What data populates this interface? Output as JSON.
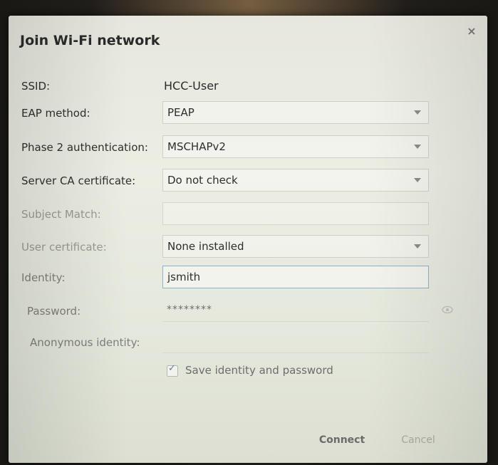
{
  "dialog": {
    "title": "Join Wi-Fi network",
    "close_icon": "close-icon"
  },
  "fields": {
    "ssid": {
      "label": "SSID:",
      "value": "HCC-User"
    },
    "eap_method": {
      "label": "EAP method:",
      "value": "PEAP"
    },
    "phase2": {
      "label": "Phase 2 authentication:",
      "value": "MSCHAPv2"
    },
    "server_ca": {
      "label": "Server CA certificate:",
      "value": "Do not check"
    },
    "subject_match": {
      "label": "Subject Match:",
      "value": ""
    },
    "user_cert": {
      "label": "User certificate:",
      "value": "None installed"
    },
    "identity": {
      "label": "Identity:",
      "value": "jsmith"
    },
    "password": {
      "label": "Password:",
      "value": "********"
    },
    "anonymous_identity": {
      "label": "Anonymous identity:",
      "value": ""
    }
  },
  "save_credentials": {
    "label": "Save identity and password",
    "checked": true
  },
  "buttons": {
    "connect": "Connect",
    "cancel": "Cancel"
  }
}
